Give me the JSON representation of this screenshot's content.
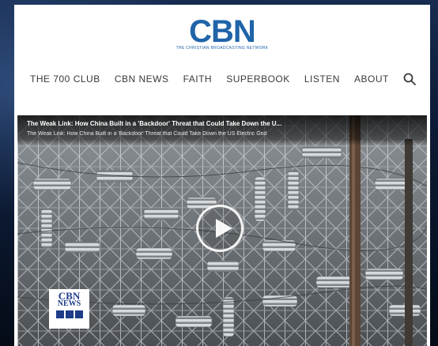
{
  "header": {
    "logo_text": "CBN",
    "logo_tagline": "THE CHRISTIAN BROADCASTING NETWORK"
  },
  "nav": {
    "items": [
      {
        "label": "THE 700 CLUB"
      },
      {
        "label": "CBN NEWS"
      },
      {
        "label": "FAITH"
      },
      {
        "label": "SUPERBOOK"
      },
      {
        "label": "LISTEN"
      },
      {
        "label": "ABOUT"
      }
    ],
    "search_icon": "search-icon"
  },
  "video": {
    "title": "The Weak Link: How China Built in a 'Backdoor' Threat that Could Take Down the U...",
    "subtitle": "The Weak Link: How China Built in a 'Backdoor' Threat that Could Take Down the US Electric Grid",
    "play_icon": "play-icon",
    "watermark": {
      "line1": "CBN",
      "line2": "NEWS",
      "icons": [
        "youtube-icon",
        "instagram-icon",
        "facebook-icon"
      ]
    }
  },
  "colors": {
    "brand": "#1f64a8",
    "nav_text": "#3a3a3a",
    "background": "#0b1830"
  }
}
